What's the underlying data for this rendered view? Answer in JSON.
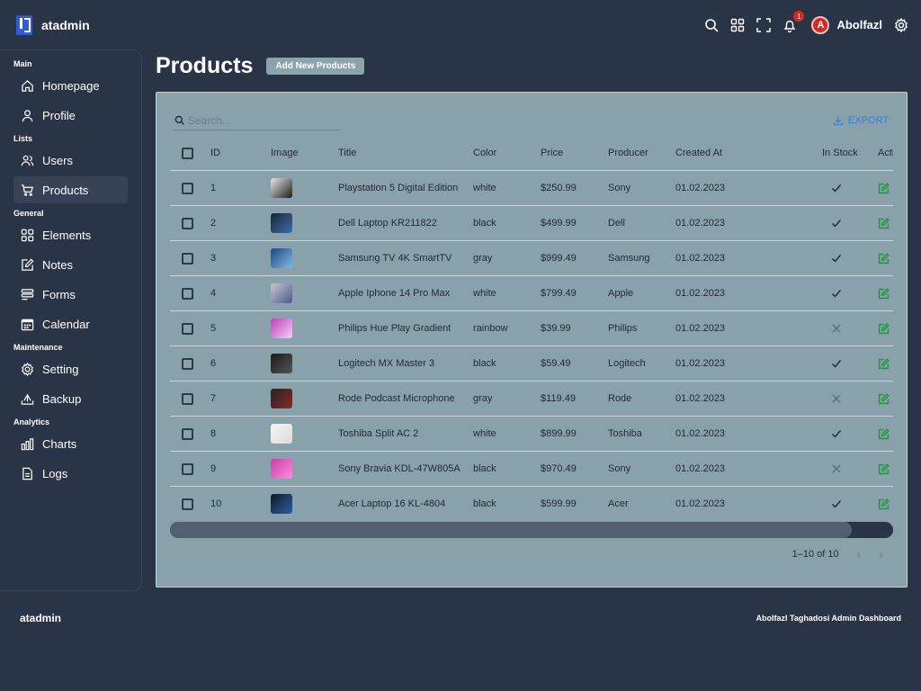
{
  "app": {
    "name": "atadmin"
  },
  "navbar": {
    "notification_count": "1",
    "user_initial": "A",
    "username": "Abolfazl"
  },
  "sidebar": {
    "sections": [
      {
        "title": "Main",
        "items": [
          {
            "label": "Homepage",
            "icon": "home-icon"
          },
          {
            "label": "Profile",
            "icon": "person-icon"
          }
        ]
      },
      {
        "title": "Lists",
        "items": [
          {
            "label": "Users",
            "icon": "users-icon"
          },
          {
            "label": "Products",
            "icon": "cart-icon",
            "active": true
          }
        ]
      },
      {
        "title": "General",
        "items": [
          {
            "label": "Elements",
            "icon": "grid-icon"
          },
          {
            "label": "Notes",
            "icon": "edit-icon"
          },
          {
            "label": "Forms",
            "icon": "forms-icon"
          },
          {
            "label": "Calendar",
            "icon": "calendar-icon"
          }
        ]
      },
      {
        "title": "Maintenance",
        "items": [
          {
            "label": "Setting",
            "icon": "gear-icon"
          },
          {
            "label": "Backup",
            "icon": "backup-icon"
          }
        ]
      },
      {
        "title": "Analytics",
        "items": [
          {
            "label": "Charts",
            "icon": "chart-icon"
          },
          {
            "label": "Logs",
            "icon": "logs-icon"
          }
        ]
      }
    ]
  },
  "page": {
    "title": "Products",
    "add_button": "Add New Products"
  },
  "toolbar": {
    "search_placeholder": "Search...",
    "export_label": "EXPORT"
  },
  "table": {
    "columns": [
      "ID",
      "Image",
      "Title",
      "Color",
      "Price",
      "Producer",
      "Created At",
      "In Stock",
      "Acti"
    ],
    "rows": [
      {
        "id": "1",
        "title": "Playstation 5 Digital Edition",
        "color": "white",
        "price": "$250.99",
        "producer": "Sony",
        "created": "01.02.2023",
        "in_stock": true
      },
      {
        "id": "2",
        "title": "Dell Laptop KR211822",
        "color": "black",
        "price": "$499.99",
        "producer": "Dell",
        "created": "01.02.2023",
        "in_stock": true
      },
      {
        "id": "3",
        "title": "Samsung TV 4K SmartTV",
        "color": "gray",
        "price": "$999.49",
        "producer": "Samsung",
        "created": "01.02.2023",
        "in_stock": true
      },
      {
        "id": "4",
        "title": "Apple Iphone 14 Pro Max",
        "color": "white",
        "price": "$799.49",
        "producer": "Apple",
        "created": "01.02.2023",
        "in_stock": true
      },
      {
        "id": "5",
        "title": "Philips Hue Play Gradient",
        "color": "rainbow",
        "price": "$39.99",
        "producer": "Philips",
        "created": "01.02.2023",
        "in_stock": false
      },
      {
        "id": "6",
        "title": "Logitech MX Master 3",
        "color": "black",
        "price": "$59.49",
        "producer": "Logitech",
        "created": "01.02.2023",
        "in_stock": true
      },
      {
        "id": "7",
        "title": "Rode Podcast Microphone",
        "color": "gray",
        "price": "$119.49",
        "producer": "Rode",
        "created": "01.02.2023",
        "in_stock": false
      },
      {
        "id": "8",
        "title": "Toshiba Split AC 2",
        "color": "white",
        "price": "$899.99",
        "producer": "Toshiba",
        "created": "01.02.2023",
        "in_stock": true
      },
      {
        "id": "9",
        "title": "Sony Bravia KDL-47W805A",
        "color": "black",
        "price": "$970.49",
        "producer": "Sony",
        "created": "01.02.2023",
        "in_stock": false
      },
      {
        "id": "10",
        "title": "Acer Laptop 16 KL-4804",
        "color": "black",
        "price": "$599.99",
        "producer": "Acer",
        "created": "01.02.2023",
        "in_stock": true
      }
    ]
  },
  "pagination": {
    "range": "1–10 of 10"
  },
  "footer": {
    "logo": "atadmin",
    "text": "Abolfazl Taghadosi Admin Dashboard"
  },
  "colors": {
    "accent": "#3b7fd4",
    "edit_green": "#1f9a3a",
    "panel": "#88a1ab",
    "bg": "#2a3447"
  }
}
